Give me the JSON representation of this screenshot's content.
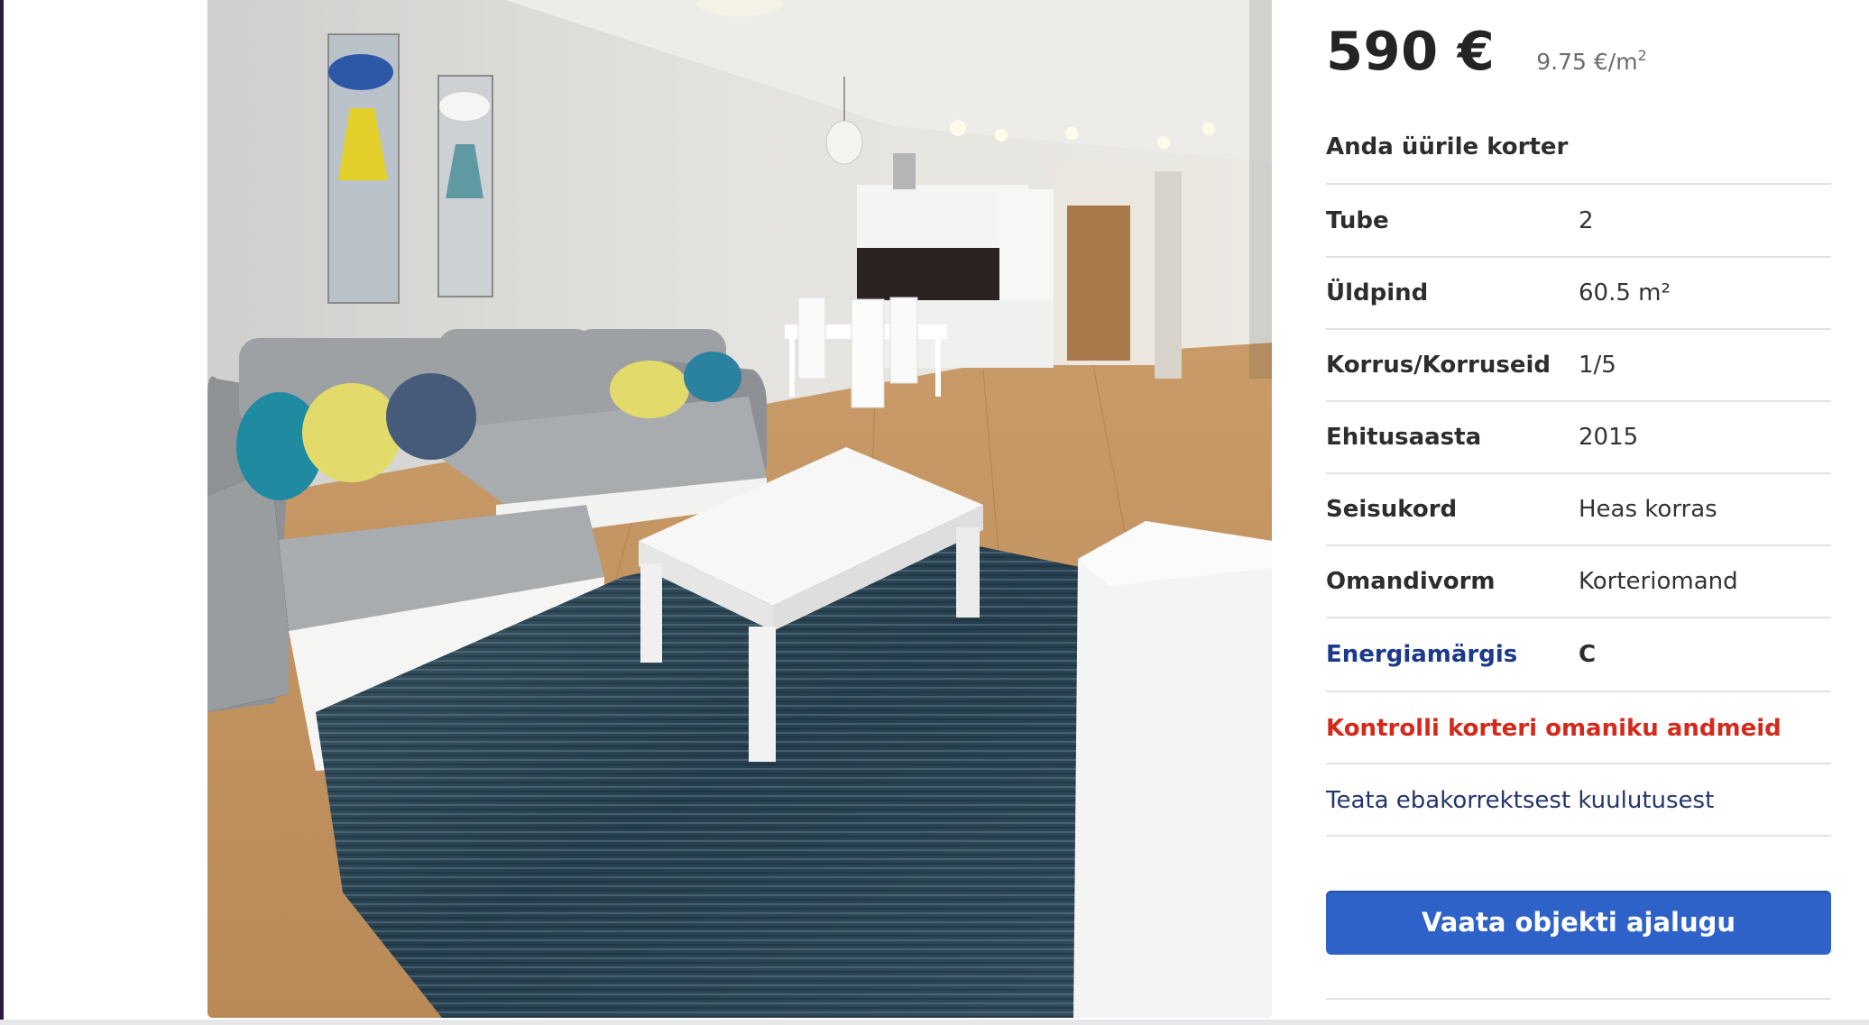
{
  "listing": {
    "price": "590 €",
    "price_per_m2_value": "9.75 €/m",
    "price_per_m2_sup": "2",
    "title": "Anda üürile korter"
  },
  "details": [
    {
      "label": "Tube",
      "value": "2"
    },
    {
      "label": "Üldpind",
      "value": "60.5 m²"
    },
    {
      "label": "Korrus/Korruseid",
      "value": "1/5"
    },
    {
      "label": "Ehitusaasta",
      "value": "2015"
    },
    {
      "label": "Seisukord",
      "value": "Heas korras"
    },
    {
      "label": "Omandivorm",
      "value": "Korteriomand"
    },
    {
      "label": "Energiamärgis",
      "value": "C"
    }
  ],
  "links": {
    "check_owner": "Kontrolli korteri omaniku andmeid",
    "report": "Teata ebakorrektsest kuulutusest"
  },
  "actions": {
    "history_button": "Vaata objekti ajalugu"
  },
  "colors": {
    "accent_blue": "#2f62c8",
    "link_red": "#d4291b",
    "link_navy": "#1c3a8a"
  }
}
